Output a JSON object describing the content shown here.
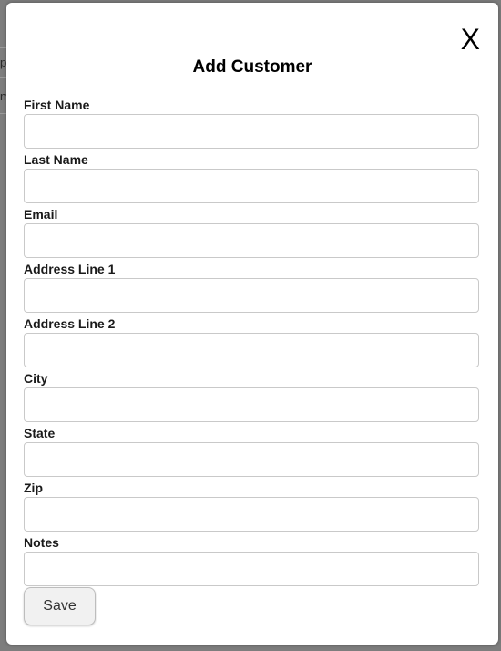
{
  "background": {
    "glyphs": [
      "p",
      "m"
    ]
  },
  "modal": {
    "close_label": "X",
    "title": "Add Customer",
    "fields": [
      {
        "label": "First Name",
        "value": "",
        "placeholder": ""
      },
      {
        "label": "Last Name",
        "value": "",
        "placeholder": ""
      },
      {
        "label": "Email",
        "value": "",
        "placeholder": ""
      },
      {
        "label": "Address Line 1",
        "value": "",
        "placeholder": ""
      },
      {
        "label": "Address Line 2",
        "value": "",
        "placeholder": ""
      },
      {
        "label": "City",
        "value": "",
        "placeholder": ""
      },
      {
        "label": "State",
        "value": "",
        "placeholder": ""
      },
      {
        "label": "Zip",
        "value": "",
        "placeholder": ""
      },
      {
        "label": "Notes",
        "value": "",
        "placeholder": ""
      }
    ],
    "save_label": "Save"
  }
}
